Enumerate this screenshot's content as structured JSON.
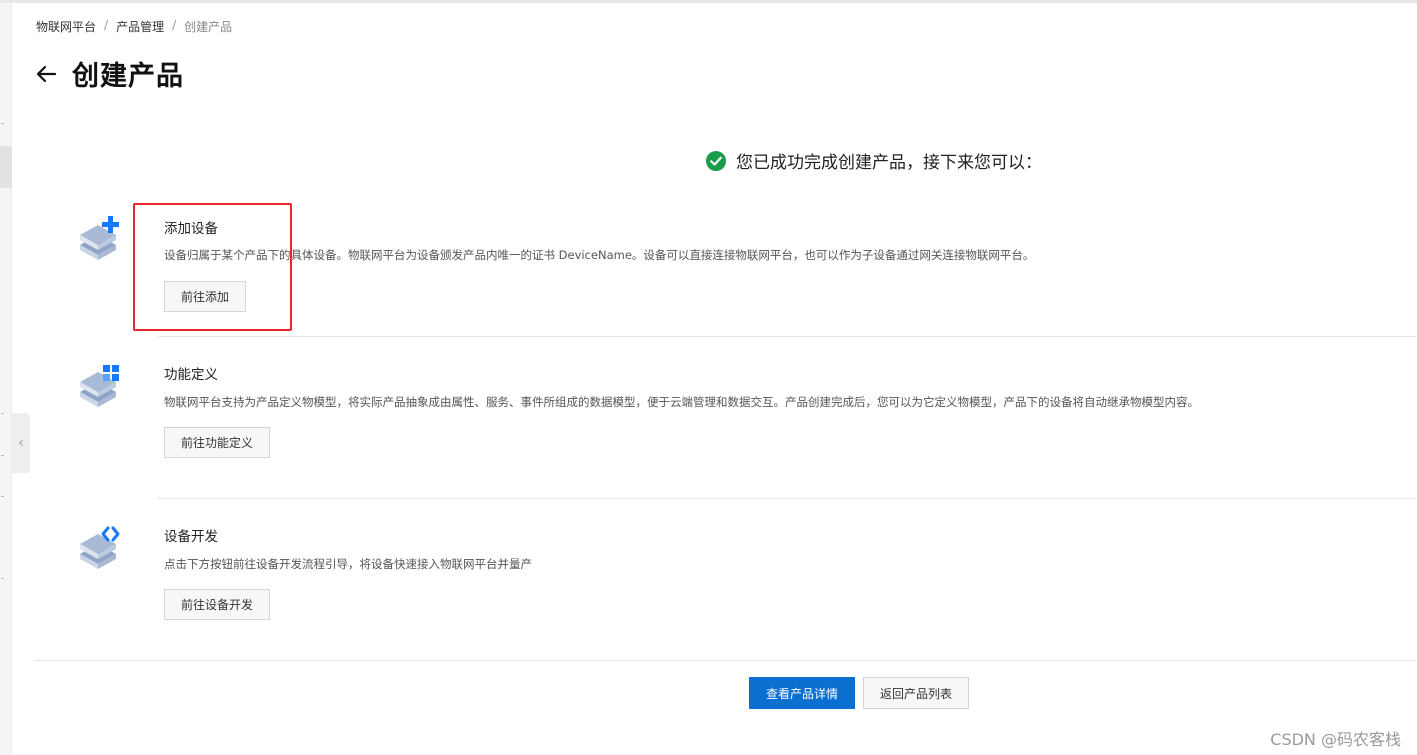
{
  "breadcrumb": {
    "items": [
      "物联网平台",
      "产品管理",
      "创建产品"
    ],
    "separator": "/"
  },
  "header": {
    "back_icon": "arrow-left-icon",
    "title": "创建产品"
  },
  "success": {
    "icon": "check-circle-icon",
    "icon_color": "#1a9b48",
    "message": "您已成功完成创建产品，接下来您可以："
  },
  "steps": [
    {
      "icon": "device-add-icon",
      "title": "添加设备",
      "description": "设备归属于某个产品下的具体设备。物联网平台为设备颁发产品内唯一的证书 DeviceName。设备可以直接连接物联网平台，也可以作为子设备通过网关连接物联网平台。",
      "button": "前往添加"
    },
    {
      "icon": "function-define-icon",
      "title": "功能定义",
      "description": "物联网平台支持为产品定义物模型，将实际产品抽象成由属性、服务、事件所组成的数据模型，便于云端管理和数据交互。产品创建完成后，您可以为它定义物模型，产品下的设备将自动继承物模型内容。",
      "button": "前往功能定义"
    },
    {
      "icon": "device-develop-icon",
      "title": "设备开发",
      "description": "点击下方按钮前往设备开发流程引导，将设备快速接入物联网平台并量产",
      "button": "前往设备开发"
    }
  ],
  "footer": {
    "primary_button": "查看产品详情",
    "secondary_button": "返回产品列表"
  },
  "watermark": "CSDN @码农客栈",
  "colors": {
    "primary": "#0a6fd1",
    "highlight": "#e5262a",
    "success": "#1a9b48",
    "icon_blue": "#1677ff"
  }
}
